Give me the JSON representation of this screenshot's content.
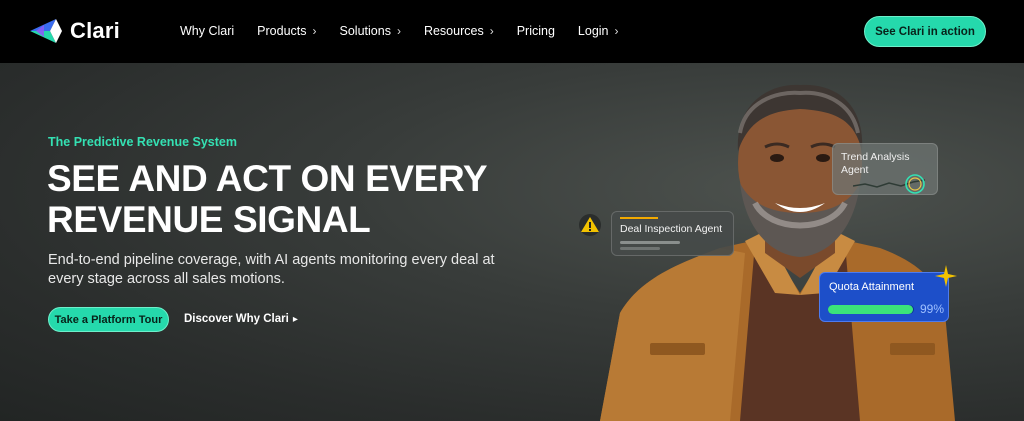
{
  "brand": {
    "name": "Clari"
  },
  "nav": {
    "items": [
      {
        "label": "Why Clari",
        "has_chevron": false
      },
      {
        "label": "Products",
        "has_chevron": true
      },
      {
        "label": "Solutions",
        "has_chevron": true
      },
      {
        "label": "Resources",
        "has_chevron": true
      },
      {
        "label": "Pricing",
        "has_chevron": false
      },
      {
        "label": "Login",
        "has_chevron": true
      }
    ],
    "chevron": "›",
    "cta": "See Clari in action"
  },
  "hero": {
    "eyebrow": "The Predictive Revenue System",
    "headline_line1": "SEE AND ACT ON EVERY",
    "headline_line2": "REVENUE SIGNAL",
    "subtext": "End-to-end pipeline coverage, with AI agents monitoring every deal at every stage across all sales motions.",
    "primary_cta": "Take a Platform Tour",
    "secondary_cta": "Discover Why Clari",
    "secondary_arrow": "▸"
  },
  "cards": {
    "trend": "Trend Analysis Agent",
    "deal": "Deal Inspection Agent",
    "quota_title": "Quota Attainment",
    "quota_value": "99%",
    "quota_progress": 0.99
  },
  "colors": {
    "accent": "#25d9ac",
    "eyebrow": "#34e1b3",
    "quota_card": "#1d4fc9",
    "progress": "#3be37a",
    "warning": "#f2c200"
  },
  "icons": [
    "clari-logo-icon",
    "chevron-right-icon",
    "warning-icon",
    "sparkle-icon",
    "trend-chart-icon"
  ]
}
